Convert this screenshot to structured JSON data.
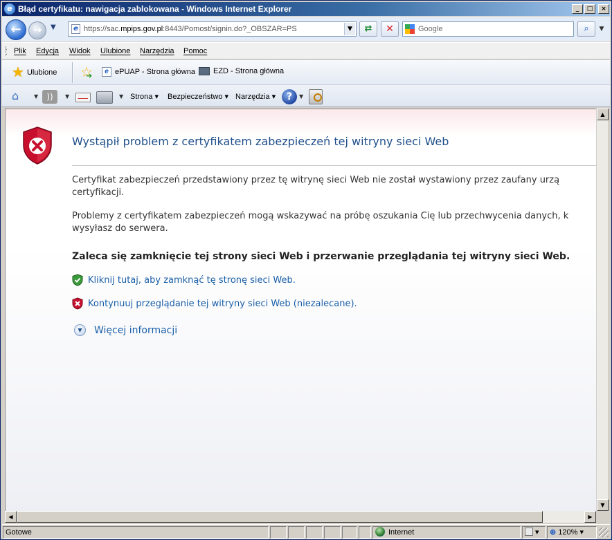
{
  "window": {
    "title": "Błąd certyfikatu: nawigacja zablokowana - Windows Internet Explorer",
    "controls": {
      "minimize": "_",
      "maximize": "□",
      "close": "×"
    }
  },
  "navigation": {
    "address_prefix": "https://sac.",
    "address_domain": "mpips.gov.pl",
    "address_suffix": ":8443/Pomost/signin.do?_OBSZAR=PS",
    "search_placeholder": "Google"
  },
  "menu": [
    "Plik",
    "Edycja",
    "Widok",
    "Ulubione",
    "Narzędzia",
    "Pomoc"
  ],
  "favorites": {
    "button_label": "Ulubione",
    "links": [
      "ePUAP - Strona główna",
      "EZD - Strona główna"
    ]
  },
  "command_bar": {
    "page_label": "Strona",
    "safety_label": "Bezpieczeństwo",
    "tools_label": "Narzędzia"
  },
  "error_page": {
    "title": "Wystąpił problem z certyfikatem zabezpieczeń tej witryny sieci Web",
    "paragraph1_line1": "Certyfikat zabezpieczeń przedstawiony przez tę witrynę sieci Web nie został wystawiony przez zaufany urzą",
    "paragraph1_line2": "certyfikacji.",
    "paragraph2_line1": "Problemy z certyfikatem zabezpieczeń mogą wskazywać na próbę oszukania Cię lub przechwycenia danych, k",
    "paragraph2_line2": "wysyłasz do serwera.",
    "recommendation": "Zaleca się zamknięcie tej strony sieci Web i przerwanie przeglądania tej witryny sieci Web.",
    "close_link": "Kliknij tutaj, aby zamknąć tę stronę sieci Web.",
    "continue_link": "Kontynuuj przeglądanie tej witryny sieci Web (niezalecane).",
    "more_info": "Więcej informacji"
  },
  "status_bar": {
    "status": "Gotowe",
    "zone": "Internet",
    "zoom": "120%"
  },
  "colors": {
    "title_gradient_start": "#0a246a",
    "link": "#1a5fa8",
    "error_title": "#1f4f8a",
    "shield_red": "#c8102e",
    "shield_green": "#3a9a3a"
  },
  "icons": {
    "back": "back-arrow-icon",
    "forward": "forward-arrow-icon",
    "refresh": "refresh-icon",
    "stop": "stop-icon",
    "search": "search-icon",
    "favorites": "star-icon",
    "home": "home-icon",
    "feeds": "rss-icon",
    "mail": "mail-icon",
    "print": "printer-icon",
    "help": "help-icon",
    "research": "research-icon",
    "error": "red-shield-x-icon",
    "close_page": "green-shield-check-icon",
    "continue": "red-shield-x-icon",
    "more": "chevron-down-circle-icon",
    "zone": "globe-icon"
  }
}
